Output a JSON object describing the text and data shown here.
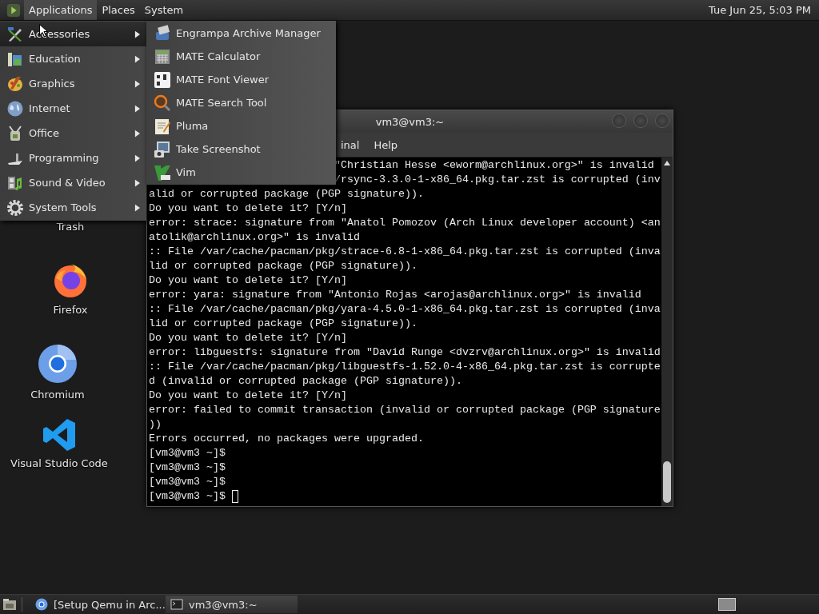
{
  "top_panel": {
    "menus": [
      {
        "label": "Applications",
        "selected": true
      },
      {
        "label": "Places",
        "selected": false
      },
      {
        "label": "System",
        "selected": false
      }
    ],
    "clock": "Tue Jun 25, 5:03 PM"
  },
  "app_menu": {
    "categories": [
      {
        "label": "Accessories",
        "selected": true
      },
      {
        "label": "Education",
        "selected": false
      },
      {
        "label": "Graphics",
        "selected": false
      },
      {
        "label": "Internet",
        "selected": false
      },
      {
        "label": "Office",
        "selected": false
      },
      {
        "label": "Programming",
        "selected": false
      },
      {
        "label": "Sound & Video",
        "selected": false
      },
      {
        "label": "System Tools",
        "selected": false
      }
    ],
    "submenu": [
      "Engrampa Archive Manager",
      "MATE Calculator",
      "MATE Font Viewer",
      "MATE Search Tool",
      "Pluma",
      "Take Screenshot",
      "Vim"
    ]
  },
  "desktop_icons": [
    {
      "label": "Trash"
    },
    {
      "label": "Firefox"
    },
    {
      "label": "Chromium"
    },
    {
      "label": "Visual Studio Code"
    }
  ],
  "terminal": {
    "title": "vm3@vm3:~",
    "menus": [
      "inal",
      "Help"
    ],
    "cursor_visible": true,
    "lines": [
      {
        "text": "\"Christian Hesse <eworm@archlinux.org>\" is invalid",
        "kind": "covered"
      },
      {
        "text": "/rsync-3.3.0-1-x86_64.pkg.tar.zst is corrupted (inv",
        "kind": "covered"
      },
      {
        "text": "alid or corrupted package (PGP signature)).",
        "kind": "full"
      },
      {
        "text": "Do you want to delete it? [Y/n]",
        "kind": "full"
      },
      {
        "text": "error: strace: signature from \"Anatol Pomozov (Arch Linux developer account) <an",
        "kind": "full"
      },
      {
        "text": "atolik@archlinux.org>\" is invalid",
        "kind": "full"
      },
      {
        "text": ":: File /var/cache/pacman/pkg/strace-6.8-1-x86_64.pkg.tar.zst is corrupted (inva",
        "kind": "full"
      },
      {
        "text": "lid or corrupted package (PGP signature)).",
        "kind": "full"
      },
      {
        "text": "Do you want to delete it? [Y/n]",
        "kind": "full"
      },
      {
        "text": "error: yara: signature from \"Antonio Rojas <arojas@archlinux.org>\" is invalid",
        "kind": "full"
      },
      {
        "text": ":: File /var/cache/pacman/pkg/yara-4.5.0-1-x86_64.pkg.tar.zst is corrupted (inva",
        "kind": "full"
      },
      {
        "text": "lid or corrupted package (PGP signature)).",
        "kind": "full"
      },
      {
        "text": "Do you want to delete it? [Y/n]",
        "kind": "full"
      },
      {
        "text": "error: libguestfs: signature from \"David Runge <dvzrv@archlinux.org>\" is invalid",
        "kind": "full"
      },
      {
        "text": ":: File /var/cache/pacman/pkg/libguestfs-1.52.0-4-x86_64.pkg.tar.zst is corrupte",
        "kind": "full"
      },
      {
        "text": "d (invalid or corrupted package (PGP signature)).",
        "kind": "full"
      },
      {
        "text": "Do you want to delete it? [Y/n]",
        "kind": "full"
      },
      {
        "text": "error: failed to commit transaction (invalid or corrupted package (PGP signature",
        "kind": "full"
      },
      {
        "text": "))",
        "kind": "full"
      },
      {
        "text": "Errors occurred, no packages were upgraded.",
        "kind": "full"
      },
      {
        "text": "[vm3@vm3 ~]$",
        "kind": "full"
      },
      {
        "text": "[vm3@vm3 ~]$",
        "kind": "full"
      },
      {
        "text": "[vm3@vm3 ~]$",
        "kind": "full"
      },
      {
        "text": "[vm3@vm3 ~]$",
        "kind": "full"
      }
    ]
  },
  "taskbar": {
    "tasks": [
      {
        "label": "[Setup Qemu in Arc...",
        "selected": false
      },
      {
        "label": "vm3@vm3:~",
        "selected": true
      }
    ]
  }
}
